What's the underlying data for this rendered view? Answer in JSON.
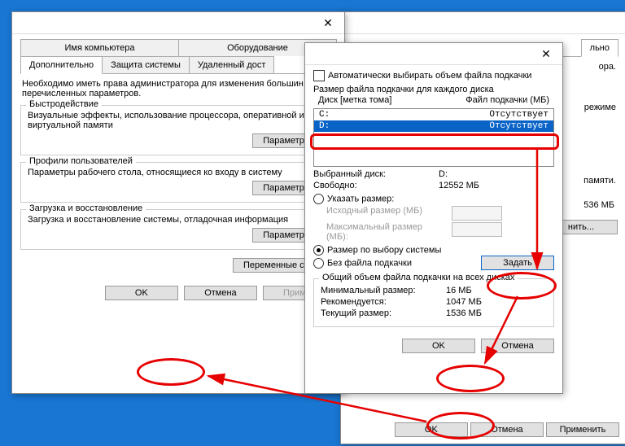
{
  "win1": {
    "tabsTop": [
      "Имя компьютера",
      "Оборудование"
    ],
    "tabsBottom": [
      "Дополнительно",
      "Защита системы",
      "Удаленный дост"
    ],
    "desc": "Необходимо иметь права администратора для изменения большин перечисленных параметров.",
    "g1": {
      "title": "Быстродействие",
      "text": "Визуальные эффекты, использование процессора, оперативной и виртуальной памяти",
      "btn": "Параметры..."
    },
    "g2": {
      "title": "Профили пользователей",
      "text": "Параметры рабочего стола, относящиеся ко входу в систему",
      "btn": "Параметры..."
    },
    "g3": {
      "title": "Загрузка и восстановление",
      "text": "Загрузка и восстановление системы, отладочная информация",
      "btn": "Параметры..."
    },
    "envBtn": "Переменные среды",
    "ok": "OK",
    "cancel": "Отмена",
    "apply": "Примен"
  },
  "win2": {
    "tab": "льно",
    "perfText": "ора.",
    "advText": "режиме",
    "memText": "памяти.",
    "memVal": "536 МБ",
    "changeBtn": "нить...",
    "ok": "OK",
    "cancel": "Отмена",
    "apply": "Применить"
  },
  "vm": {
    "auto": "Автоматически выбирать объем файла подкачки",
    "perDisk": "Размер файла подкачки для каждого диска",
    "colDisk": "Диск [метка тома]",
    "colFile": "Файл подкачки (МБ)",
    "rows": [
      {
        "d": "C:",
        "f": "Отсутствует"
      },
      {
        "d": "D:",
        "f": "Отсутствует"
      }
    ],
    "selLbl": "Выбранный диск:",
    "selVal": "D:",
    "freeLbl": "Свободно:",
    "freeVal": "12552 МБ",
    "custom": "Указать размер:",
    "init": "Исходный размер (МБ)",
    "max": "Максимальный размер (МБ):",
    "sys": "Размер по выбору системы",
    "none": "Без файла подкачки",
    "set": "Задать",
    "totalTitle": "Общий объем файла подкачки на всех дисках",
    "minLbl": "Минимальный размер:",
    "minVal": "16 МБ",
    "recLbl": "Рекомендуется:",
    "recVal": "1047 МБ",
    "curLbl": "Текущий размер:",
    "curVal": "1536 МБ",
    "ok": "OK",
    "cancel": "Отмена"
  }
}
